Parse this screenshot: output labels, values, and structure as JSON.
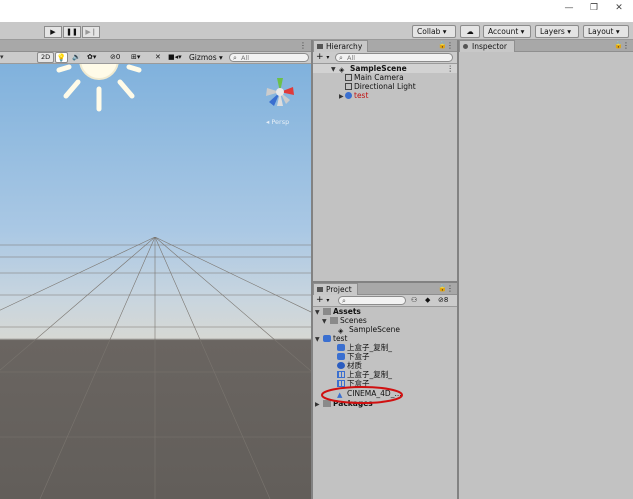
{
  "toolbar": {
    "play": "▶",
    "pause": "❚❚",
    "step": "▶❙",
    "collab": "Collab ▾",
    "account": "Account",
    "layers": "Layers",
    "layout": "Layout"
  },
  "scene": {
    "mode_2d": "2D",
    "hidden_count": "0",
    "gizmos": "Gizmos",
    "search_placeholder": "All",
    "persp": "Persp"
  },
  "hierarchy": {
    "tab": "Hierarchy",
    "search_placeholder": "All",
    "scene_name": "SampleScene",
    "items": [
      "Main Camera",
      "Directional Light",
      "test"
    ]
  },
  "inspector": {
    "tab": "Inspector"
  },
  "project": {
    "tab": "Project",
    "count": "8",
    "assets_label": "Assets",
    "scenes_label": "Scenes",
    "scene_file": "SampleScene",
    "test_label": "test",
    "test_items": [
      "上盒子_复制_",
      "下盒子",
      "材质",
      "上盒子_复制_",
      "下盒子",
      "CINEMA_4D_..."
    ],
    "packages_label": "Packages"
  },
  "colors": {
    "annotation_circle": "#d01010",
    "sky_top": "#7db0dc",
    "ground": "#625e5a",
    "prefab_blue": "#3a6fd0"
  }
}
